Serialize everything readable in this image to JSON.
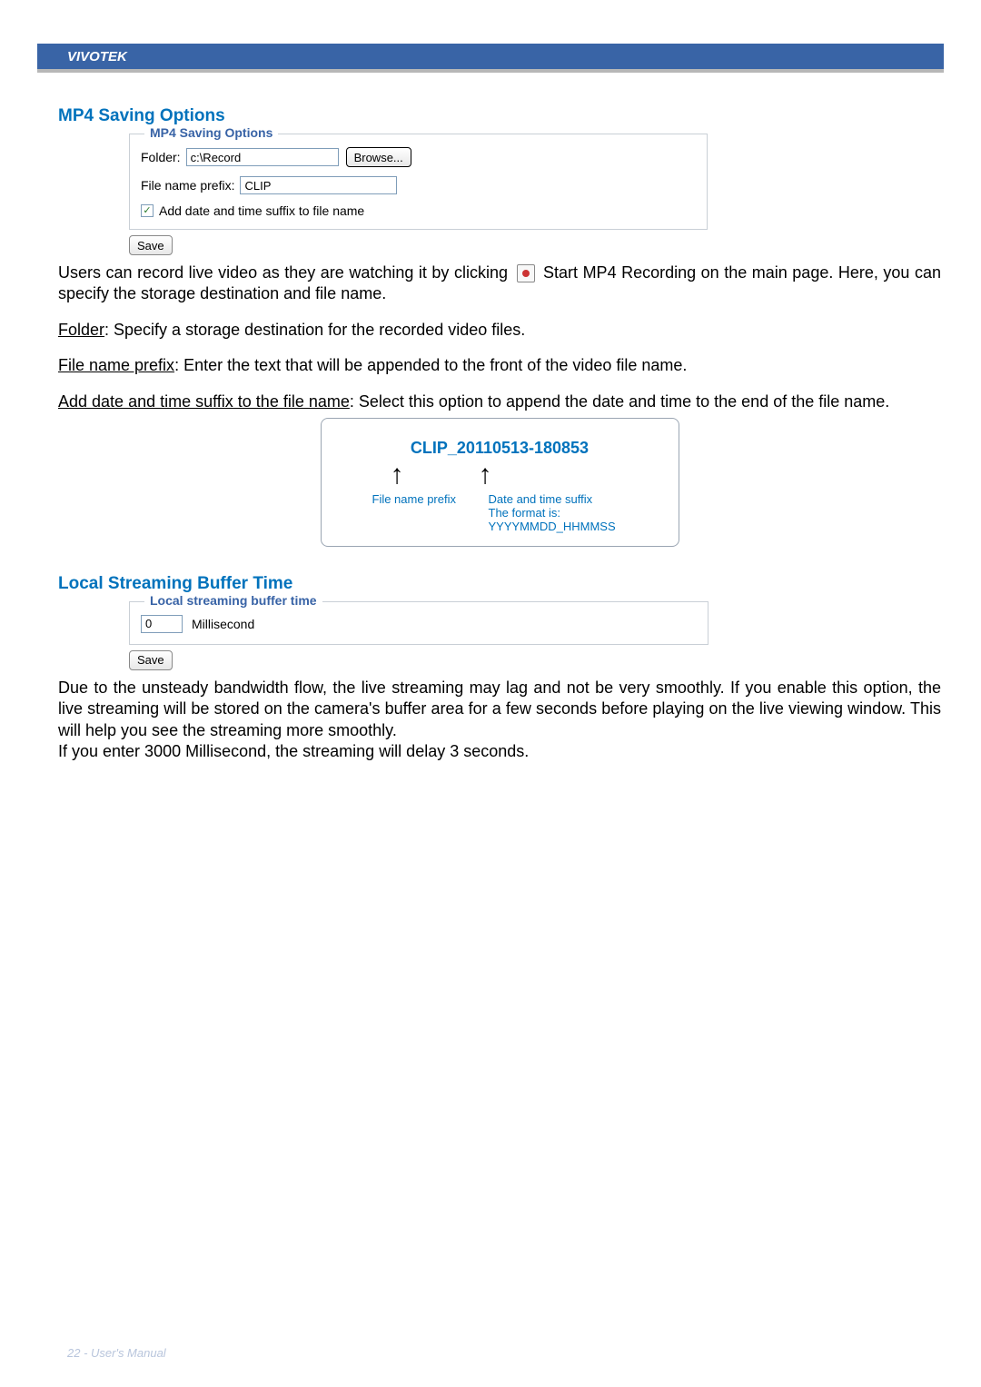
{
  "header": {
    "brand": "VIVOTEK"
  },
  "section1": {
    "heading": "MP4 Saving Options",
    "fieldset_legend": "MP4 Saving Options",
    "folder_label": "Folder:",
    "folder_value": "c:\\Record",
    "browse_label": "Browse...",
    "prefix_label": "File name prefix:",
    "prefix_value": "CLIP",
    "checkbox_label": "Add date and time suffix to file name",
    "checkbox_checked": "✓",
    "save_label": "Save"
  },
  "body1": {
    "p1a": "Users can record live video as they are watching it by clicking",
    "p1b": "Start MP4 Recording on the main page. Here, you can specify the storage destination and file name.",
    "p2_label": "Folder",
    "p2_text": ": Specify a storage destination for the recorded video files.",
    "p3_label": "File name prefix",
    "p3_text": ": Enter the text that will be appended to the front of the video file name.",
    "p4_label": "Add date and time suffix to the file name",
    "p4_text": ": Select this option to append the date and time to the end of the file name."
  },
  "filename_example": {
    "text": "CLIP_20110513-180853",
    "label1": "File name prefix",
    "label2": "Date and time suffix",
    "format": "The format is: YYYYMMDD_HHMMSS"
  },
  "section2": {
    "heading": "Local Streaming Buffer Time",
    "fieldset_legend": "Local streaming buffer time",
    "value": "0",
    "unit": "Millisecond",
    "save_label": "Save"
  },
  "body2": {
    "p1": "Due to the unsteady bandwidth flow, the live streaming may lag and not be very smoothly. If you enable this option, the live streaming will be stored on the camera's buffer area for a few seconds before playing on the live viewing window. This will help you see the streaming more smoothly.",
    "p2": "If you enter 3000 Millisecond, the streaming will delay 3 seconds."
  },
  "footer": {
    "text": "22 - User's Manual"
  }
}
